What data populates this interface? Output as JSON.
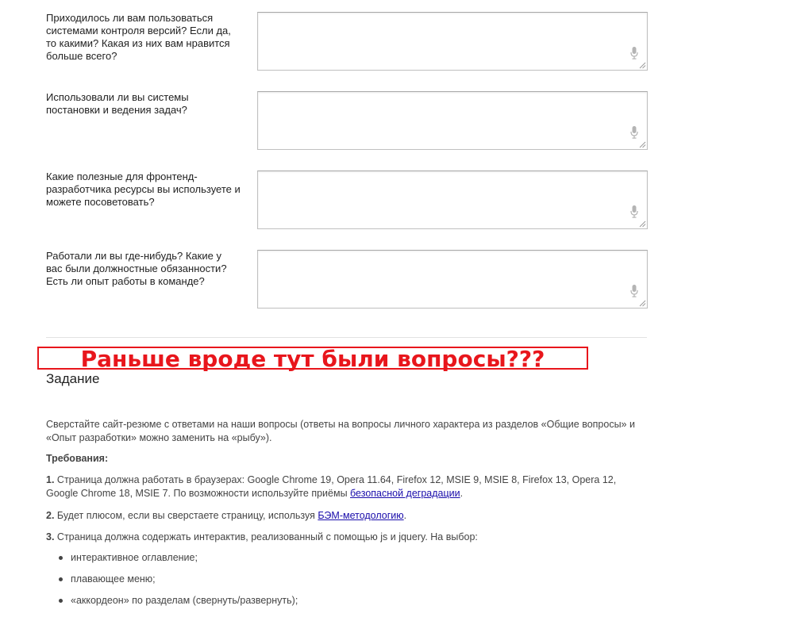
{
  "questions": [
    {
      "label": "Приходилось ли вам пользоваться системами контроля версий? Если да, то какими? Какая из них вам нравится больше всего?",
      "value": ""
    },
    {
      "label": "Использовали ли вы системы постановки и ведения задач?",
      "value": ""
    },
    {
      "label": "Какие полезные для фронтенд-разработчика ресурсы вы используете и можете посоветовать?",
      "value": ""
    },
    {
      "label": "Работали ли вы где-нибудь? Какие у вас были должностные обязанности? Есть ли опыт работы в команде?",
      "value": ""
    }
  ],
  "annotation": {
    "text": "Раньше вроде тут были вопросы???",
    "color": "#e8161c"
  },
  "task": {
    "title": "Задание",
    "intro": "Сверстайте сайт-резюме с ответами на наши вопросы (ответы на вопросы личного характера из разделов «Общие вопросы» и «Опыт разработки» можно заменить на «рыбу»).",
    "requirements_title": "Требования:",
    "req1": {
      "num": "1.",
      "text": " Страница должна работать в браузерах: Google Chrome 19, Opera 11.64, Firefox 12, MSIE 9, MSIE 8, Firefox 13, Opera 12, Google Chrome 18, MSIE 7. По возможности используйте приёмы ",
      "link": "безопасной деградации",
      "tail": "."
    },
    "req2": {
      "num": "2.",
      "text": " Будет плюсом, если вы сверстаете страницу, используя ",
      "link": "БЭМ-методологию",
      "tail": "."
    },
    "req3": {
      "num": "3.",
      "text": " Страница должна содержать интерактив, реализованный с помощью js и jquery. На выбор:"
    },
    "options": [
      "интерактивное оглавление;",
      "плавающее меню;",
      "«аккордеон» по разделам (свернуть/развернуть);"
    ]
  },
  "colors": {
    "link": "#1a0dab",
    "text": "#444444",
    "border": "#c0c0c0"
  }
}
